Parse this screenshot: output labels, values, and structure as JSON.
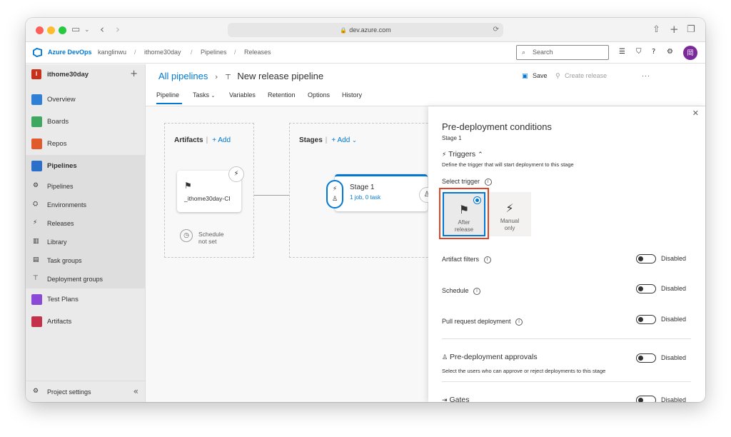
{
  "browser": {
    "url": "dev.azure.com"
  },
  "header": {
    "brand": "Azure DevOps",
    "breadcrumbs": [
      "kanglinwu",
      "ithome30day",
      "Pipelines",
      "Releases"
    ],
    "search_placeholder": "Search",
    "avatar_initial": "岡"
  },
  "sidebar": {
    "project": "ithome30day",
    "project_initial": "I",
    "items": [
      {
        "label": "Overview"
      },
      {
        "label": "Boards"
      },
      {
        "label": "Repos"
      },
      {
        "label": "Pipelines"
      },
      {
        "label": "Test Plans"
      },
      {
        "label": "Artifacts"
      }
    ],
    "subitems": [
      {
        "label": "Pipelines"
      },
      {
        "label": "Environments"
      },
      {
        "label": "Releases"
      },
      {
        "label": "Library"
      },
      {
        "label": "Task groups"
      },
      {
        "label": "Deployment groups"
      }
    ],
    "settings": "Project settings"
  },
  "page": {
    "all_pipelines": "All pipelines",
    "title": "New release pipeline",
    "save": "Save",
    "create_release": "Create release",
    "more": "···",
    "tabs": [
      "Pipeline",
      "Tasks",
      "Variables",
      "Retention",
      "Options",
      "History"
    ]
  },
  "canvas": {
    "artifacts_title": "Artifacts",
    "stages_title": "Stages",
    "add": "Add",
    "artifact_name": "_ithome30day-CI",
    "schedule_line1": "Schedule",
    "schedule_line2": "not set",
    "stage_name": "Stage 1",
    "stage_detail": "1 job, 0 task"
  },
  "panel": {
    "title": "Pre-deployment conditions",
    "subtitle": "Stage 1",
    "triggers_title": "Triggers",
    "triggers_desc": "Define the trigger that will start deployment to this stage",
    "select_trigger": "Select trigger",
    "trigger_after_1": "After",
    "trigger_after_2": "release",
    "trigger_manual_1": "Manual",
    "trigger_manual_2": "only",
    "artifact_filters": "Artifact filters",
    "schedule": "Schedule",
    "pull_request": "Pull request deployment",
    "approvals_title": "Pre-deployment approvals",
    "approvals_desc": "Select the users who can approve or reject deployments to this stage",
    "gates_title": "Gates",
    "disabled": "Disabled"
  }
}
